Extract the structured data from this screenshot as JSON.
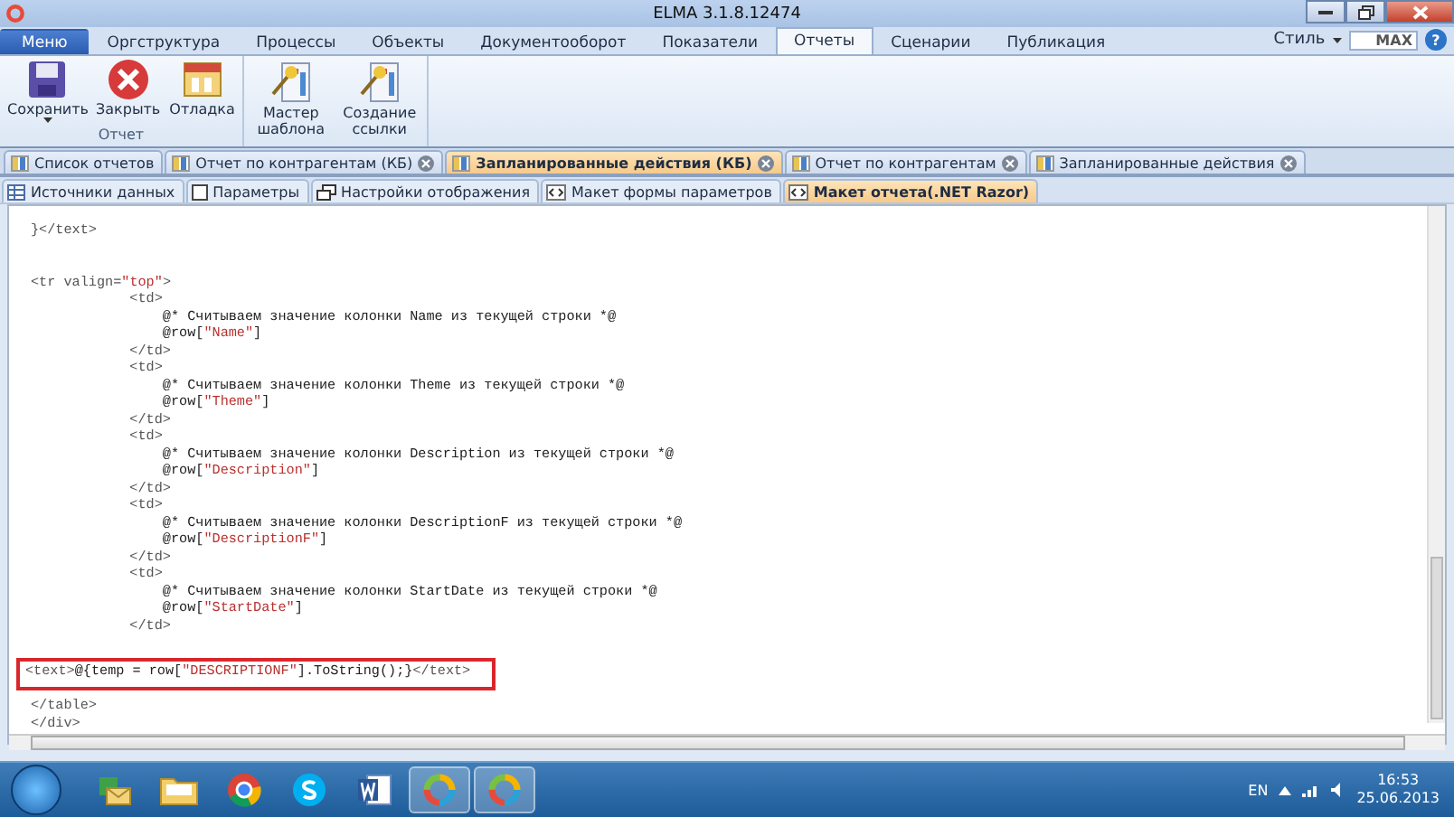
{
  "window": {
    "title": "ELMA 3.1.8.12474"
  },
  "ribbon_tabs": [
    {
      "label": "Меню",
      "kind": "menu",
      "selected": false
    },
    {
      "label": "Оргструктура",
      "kind": "tab",
      "selected": false
    },
    {
      "label": "Процессы",
      "kind": "tab",
      "selected": false
    },
    {
      "label": "Объекты",
      "kind": "tab",
      "selected": false
    },
    {
      "label": "Документооборот",
      "kind": "tab",
      "selected": false
    },
    {
      "label": "Показатели",
      "kind": "tab",
      "selected": false
    },
    {
      "label": "Отчеты",
      "kind": "tab",
      "selected": true
    },
    {
      "label": "Сценарии",
      "kind": "tab",
      "selected": false
    },
    {
      "label": "Публикация",
      "kind": "tab",
      "selected": false
    }
  ],
  "ribbon_right": {
    "style_label": "Стиль",
    "max_label": "MAX",
    "help": "?"
  },
  "ribbon_groups": [
    {
      "label": "Отчет",
      "buttons": [
        {
          "label": "Сохранить",
          "dropdown": true
        },
        {
          "label": "Закрыть",
          "dropdown": false
        },
        {
          "label": "Отладка",
          "dropdown": false
        }
      ]
    },
    {
      "buttons": [
        {
          "label": "Мастер шаблона",
          "dropdown": false
        },
        {
          "label": "Создание ссылки",
          "dropdown": false
        }
      ]
    }
  ],
  "document_tabs": [
    {
      "label": "Список отчетов",
      "closable": false,
      "selected": false
    },
    {
      "label": "Отчет по контрагентам (КБ)",
      "closable": true,
      "selected": false
    },
    {
      "label": "Запланированные действия (КБ)",
      "closable": true,
      "selected": true
    },
    {
      "label": "Отчет по контрагентам",
      "closable": true,
      "selected": false
    },
    {
      "label": "Запланированные действия",
      "closable": true,
      "selected": false
    }
  ],
  "editor_tabs": [
    {
      "label": "Источники данных",
      "selected": false
    },
    {
      "label": "Параметры",
      "selected": false
    },
    {
      "label": "Настройки отображения",
      "selected": false
    },
    {
      "label": "Макет формы параметров",
      "selected": false
    },
    {
      "label": "Макет отчета(.NET Razor)",
      "selected": true
    }
  ],
  "code_lines": [
    {
      "highlighted": false,
      "segments": [
        {
          "kind": "tag",
          "text": "}</text>"
        }
      ]
    },
    {
      "highlighted": false,
      "segments": [
        {
          "kind": "tag",
          "text": "<tr valign="
        },
        {
          "kind": "string",
          "text": "\"top\""
        },
        {
          "kind": "tag",
          "text": ">"
        }
      ]
    },
    {
      "highlighted": false,
      "segments": [
        {
          "kind": "tag",
          "text": "            <td>"
        }
      ]
    },
    {
      "highlighted": false,
      "segments": [
        {
          "kind": "code",
          "text": "                @* Считываем значение колонки Name из текущей строки *@"
        }
      ]
    },
    {
      "highlighted": false,
      "segments": [
        {
          "kind": "code",
          "text": "                @row["
        },
        {
          "kind": "string",
          "text": "\"Name\""
        },
        {
          "kind": "code",
          "text": "]"
        }
      ]
    },
    {
      "highlighted": false,
      "segments": [
        {
          "kind": "tag",
          "text": "            </td>"
        }
      ]
    },
    {
      "highlighted": false,
      "segments": [
        {
          "kind": "tag",
          "text": "            <td>"
        }
      ]
    },
    {
      "highlighted": false,
      "segments": [
        {
          "kind": "code",
          "text": "                @* Считываем значение колонки Theme из текущей строки *@"
        }
      ]
    },
    {
      "highlighted": false,
      "segments": [
        {
          "kind": "code",
          "text": "                @row["
        },
        {
          "kind": "string",
          "text": "\"Theme\""
        },
        {
          "kind": "code",
          "text": "]"
        }
      ]
    },
    {
      "highlighted": false,
      "segments": [
        {
          "kind": "tag",
          "text": "            </td>"
        }
      ]
    },
    {
      "highlighted": false,
      "segments": [
        {
          "kind": "tag",
          "text": "            <td>"
        }
      ]
    },
    {
      "highlighted": false,
      "segments": [
        {
          "kind": "code",
          "text": "                @* Считываем значение колонки Description из текущей строки *@"
        }
      ]
    },
    {
      "highlighted": false,
      "segments": [
        {
          "kind": "code",
          "text": "                @row["
        },
        {
          "kind": "string",
          "text": "\"Description\""
        },
        {
          "kind": "code",
          "text": "]"
        }
      ]
    },
    {
      "highlighted": false,
      "segments": [
        {
          "kind": "tag",
          "text": "            </td>"
        }
      ]
    },
    {
      "highlighted": false,
      "segments": [
        {
          "kind": "tag",
          "text": "            <td>"
        }
      ]
    },
    {
      "highlighted": false,
      "segments": [
        {
          "kind": "code",
          "text": "                @* Считываем значение колонки DescriptionF из текущей строки *@"
        }
      ]
    },
    {
      "highlighted": false,
      "segments": [
        {
          "kind": "code",
          "text": "                @row["
        },
        {
          "kind": "string",
          "text": "\"DescriptionF\""
        },
        {
          "kind": "code",
          "text": "]"
        }
      ]
    },
    {
      "highlighted": false,
      "segments": [
        {
          "kind": "tag",
          "text": "            </td>"
        }
      ]
    },
    {
      "highlighted": false,
      "segments": [
        {
          "kind": "tag",
          "text": "            <td>"
        }
      ]
    },
    {
      "highlighted": false,
      "segments": [
        {
          "kind": "code",
          "text": "                @* Считываем значение колонки StartDate из текущей строки *@"
        }
      ]
    },
    {
      "highlighted": false,
      "segments": [
        {
          "kind": "code",
          "text": "                @row["
        },
        {
          "kind": "string",
          "text": "\"StartDate\""
        },
        {
          "kind": "code",
          "text": "]"
        }
      ]
    },
    {
      "highlighted": false,
      "segments": [
        {
          "kind": "tag",
          "text": "            </td>"
        }
      ]
    },
    {
      "highlighted": true,
      "segments": [
        {
          "kind": "tag",
          "text": "<text>"
        },
        {
          "kind": "code",
          "text": "@{temp = row["
        },
        {
          "kind": "string",
          "text": "\"DESCRIPTIONF\""
        },
        {
          "kind": "code",
          "text": "].ToString();}"
        },
        {
          "kind": "tag",
          "text": "</text>"
        }
      ]
    },
    {
      "highlighted": false,
      "segments": [
        {
          "kind": "tag",
          "text": "</table>"
        }
      ]
    },
    {
      "highlighted": false,
      "segments": [
        {
          "kind": "tag",
          "text": "</div>"
        }
      ]
    }
  ],
  "taskbar": {
    "apps": [
      {
        "selected": false
      },
      {
        "selected": false
      },
      {
        "selected": false
      },
      {
        "selected": false
      },
      {
        "selected": false
      },
      {
        "selected": true
      },
      {
        "selected": true
      }
    ],
    "language": "EN",
    "time": "16:53",
    "date": "25.06.2013"
  }
}
